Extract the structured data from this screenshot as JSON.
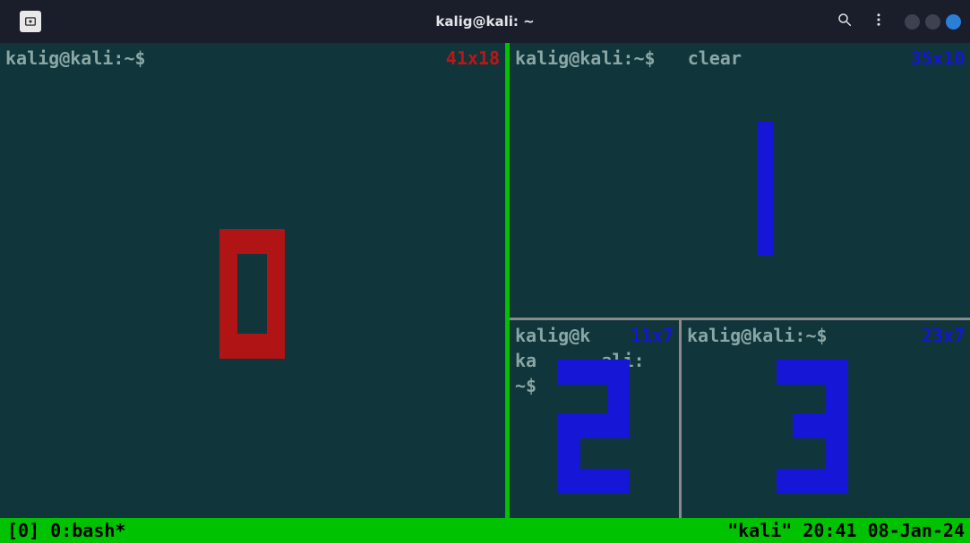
{
  "titlebar": {
    "title": "kalig@kali: ~",
    "newtab_icon": "new-tab",
    "search_icon": "search",
    "menu_icon": "kebab-menu"
  },
  "panes": {
    "p0": {
      "prompt": "kalig@kali:~$",
      "command": "",
      "dims": "41x18",
      "dims_color": "red",
      "digit": "0",
      "digit_color": "#b01414",
      "active": true
    },
    "p1": {
      "prompt": "kalig@kali:~$",
      "command": "clear",
      "dims": "35x10",
      "dims_color": "blue",
      "digit": "1",
      "digit_color": "#1616d6"
    },
    "p2": {
      "prompt_line1": "kalig@k",
      "prompt_line2": "ka      ali:",
      "prompt_line3": "~$",
      "dims": "11x7",
      "dims_color": "blue",
      "digit": "2",
      "digit_color": "#1616d6"
    },
    "p3": {
      "prompt": "kalig@kali:~$",
      "command": "",
      "dims": "23x7",
      "dims_color": "blue",
      "digit": "3",
      "digit_color": "#1616d6"
    }
  },
  "statusbar": {
    "left": "[0] 0:bash*",
    "right": "\"kali\" 20:41 08-Jan-24"
  },
  "colors": {
    "bg": "#10353b",
    "green": "#00c200",
    "grey": "#8a8a8a",
    "blue": "#1616d6",
    "red": "#b01414",
    "titlebar": "#1a1d2a"
  }
}
